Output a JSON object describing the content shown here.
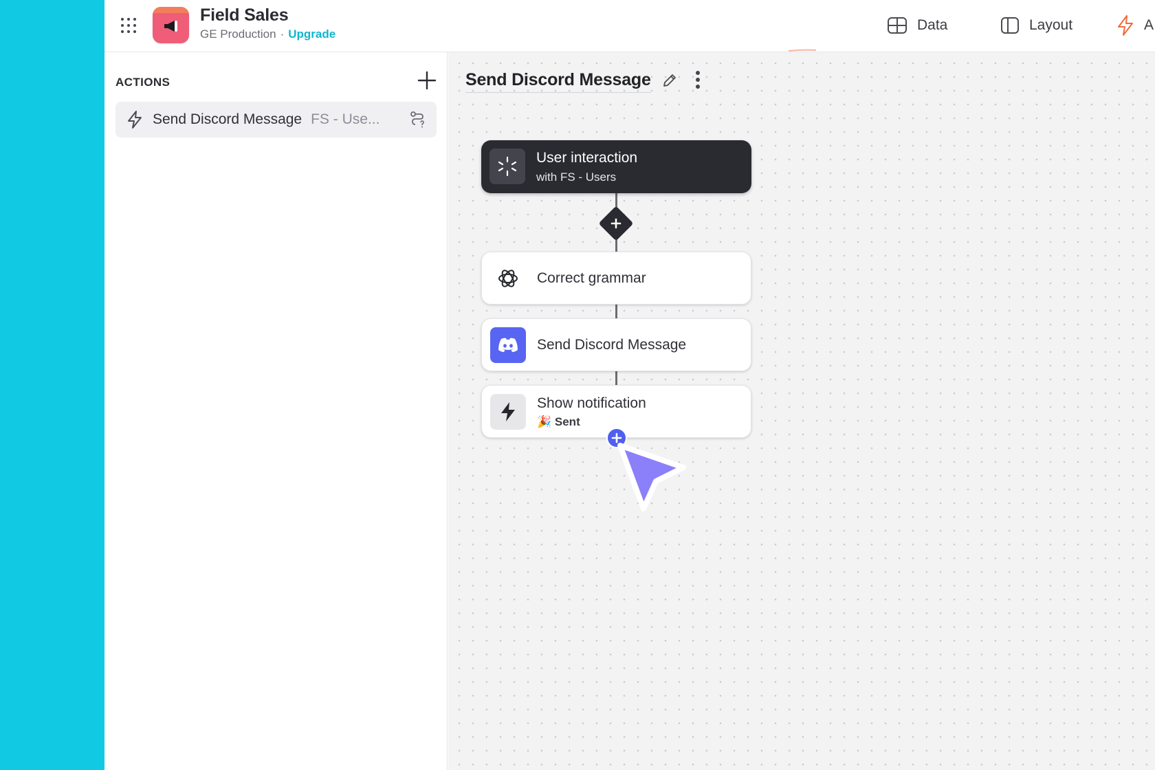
{
  "header": {
    "app_title": "Field Sales",
    "environment": "GE Production",
    "separator": "·",
    "upgrade_label": "Upgrade",
    "nav": {
      "data_label": "Data",
      "layout_label": "Layout",
      "actions_label": "A"
    }
  },
  "sidebar": {
    "title": "ACTIONS",
    "items": [
      {
        "name": "Send Discord Message",
        "table": "FS - Use..."
      }
    ]
  },
  "canvas": {
    "flow_title": "Send Discord Message",
    "nodes": {
      "trigger": {
        "label": "User interaction",
        "sub": "with FS - Users"
      },
      "grammar": {
        "label": "Correct grammar"
      },
      "discord": {
        "label": "Send Discord Message"
      },
      "notify": {
        "label": "Show notification",
        "sub": "🎉 Sent"
      }
    }
  },
  "colors": {
    "brand_cyan": "#12c9e3",
    "upgrade": "#12b5cf",
    "discord": "#5865f2",
    "add_step": "#4f5ff0",
    "cursor": "#8b80f9",
    "actions_accent": "#f06a3a"
  },
  "icons": {
    "app_menu": "grid-icon",
    "logo": "megaphone-icon",
    "data": "table-icon",
    "layout": "layout-icon",
    "actions": "bolt-icon",
    "trigger": "loading-sparkle-icon",
    "grammar": "openai-icon",
    "discord": "discord-icon",
    "notify": "bolt-icon"
  }
}
